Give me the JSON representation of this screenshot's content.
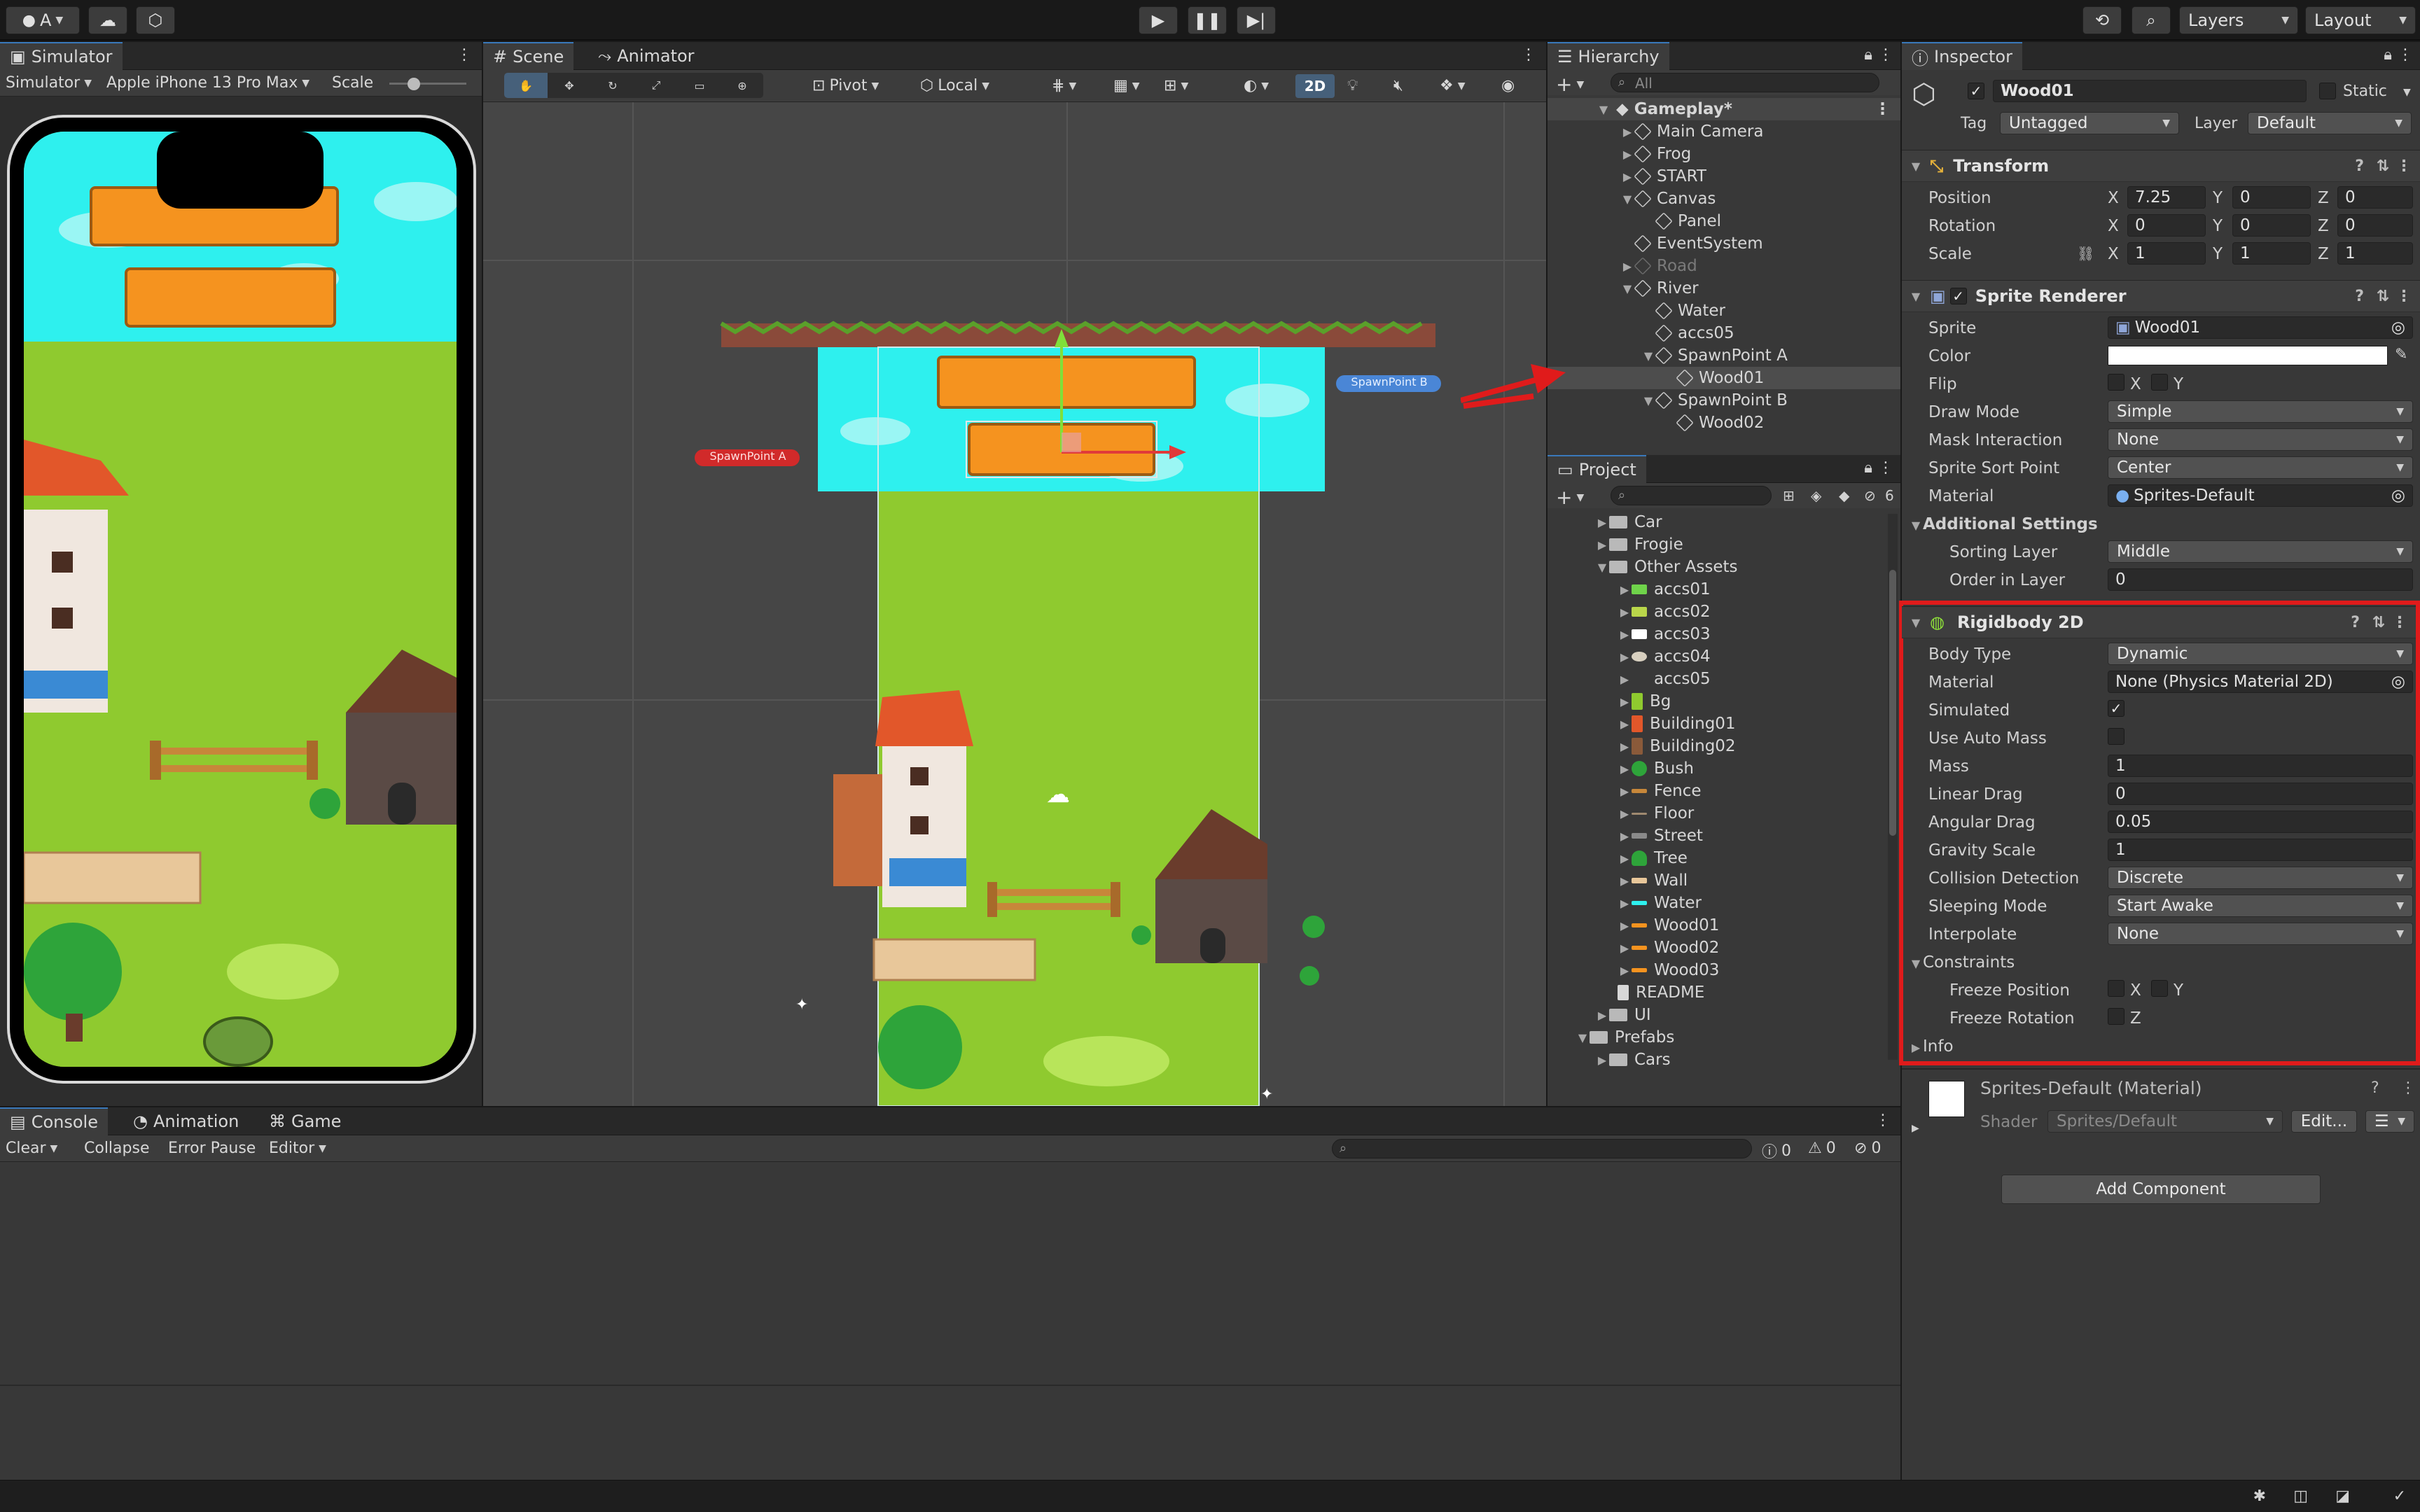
{
  "topbar": {
    "account_label": "A",
    "layers_label": "Layers",
    "layout_label": "Layout"
  },
  "simulator": {
    "tab": "Simulator",
    "mode": "Simulator",
    "device": "Apple iPhone 13 Pro Max",
    "scale_label": "Scale"
  },
  "scene": {
    "tab_scene": "Scene",
    "tab_animator": "Animator",
    "pivot": "Pivot",
    "local": "Local",
    "mode_2d": "2D",
    "spawn_a": "SpawnPoint A",
    "spawn_b": "SpawnPoint B"
  },
  "hierarchy": {
    "tab": "Hierarchy",
    "search_placeholder": "All",
    "scene_name": "Gameplay*",
    "items": [
      {
        "label": "Main Camera"
      },
      {
        "label": "Frog"
      },
      {
        "label": "START"
      },
      {
        "label": "Canvas"
      },
      {
        "label": "Panel"
      },
      {
        "label": "EventSystem"
      },
      {
        "label": "Road"
      },
      {
        "label": "River"
      },
      {
        "label": "Water"
      },
      {
        "label": "accs05"
      },
      {
        "label": "SpawnPoint A"
      },
      {
        "label": "Wood01"
      },
      {
        "label": "SpawnPoint B"
      },
      {
        "label": "Wood02"
      }
    ]
  },
  "project": {
    "tab": "Project",
    "hidden_count": "6",
    "items": [
      {
        "label": "Car"
      },
      {
        "label": "Frogie"
      },
      {
        "label": "Other Assets"
      },
      {
        "label": "accs01"
      },
      {
        "label": "accs02"
      },
      {
        "label": "accs03"
      },
      {
        "label": "accs04"
      },
      {
        "label": "accs05"
      },
      {
        "label": "Bg"
      },
      {
        "label": "Building01"
      },
      {
        "label": "Building02"
      },
      {
        "label": "Bush"
      },
      {
        "label": "Fence"
      },
      {
        "label": "Floor"
      },
      {
        "label": "Street"
      },
      {
        "label": "Tree"
      },
      {
        "label": "Wall"
      },
      {
        "label": "Water"
      },
      {
        "label": "Wood01"
      },
      {
        "label": "Wood02"
      },
      {
        "label": "Wood03"
      },
      {
        "label": "README"
      },
      {
        "label": "UI"
      },
      {
        "label": "Prefabs"
      },
      {
        "label": "Cars"
      }
    ]
  },
  "inspector": {
    "tab": "Inspector",
    "object_name": "Wood01",
    "static_label": "Static",
    "tag_label": "Tag",
    "tag_value": "Untagged",
    "layer_label": "Layer",
    "layer_value": "Default",
    "transform": {
      "title": "Transform",
      "position_label": "Position",
      "rotation_label": "Rotation",
      "scale_label": "Scale",
      "pos_x": "7.25",
      "pos_y": "0",
      "pos_z": "0",
      "rot_x": "0",
      "rot_y": "0",
      "rot_z": "0",
      "scl_x": "1",
      "scl_y": "1",
      "scl_z": "1"
    },
    "sprite_renderer": {
      "title": "Sprite Renderer",
      "sprite_label": "Sprite",
      "sprite_value": "Wood01",
      "color_label": "Color",
      "flip_label": "Flip",
      "draw_mode_label": "Draw Mode",
      "draw_mode_value": "Simple",
      "mask_label": "Mask Interaction",
      "mask_value": "None",
      "sort_point_label": "Sprite Sort Point",
      "sort_point_value": "Center",
      "material_label": "Material",
      "material_value": "Sprites-Default",
      "additional_label": "Additional Settings",
      "sorting_layer_label": "Sorting Layer",
      "sorting_layer_value": "Middle",
      "order_label": "Order in Layer",
      "order_value": "0"
    },
    "rigidbody": {
      "title": "Rigidbody 2D",
      "body_type_label": "Body Type",
      "body_type_value": "Dynamic",
      "material_label": "Material",
      "material_value": "None (Physics Material 2D)",
      "simulated_label": "Simulated",
      "auto_mass_label": "Use Auto Mass",
      "mass_label": "Mass",
      "mass_value": "1",
      "linear_drag_label": "Linear Drag",
      "linear_drag_value": "0",
      "angular_drag_label": "Angular Drag",
      "angular_drag_value": "0.05",
      "gravity_label": "Gravity Scale",
      "gravity_value": "1",
      "collision_label": "Collision Detection",
      "collision_value": "Discrete",
      "sleeping_label": "Sleeping Mode",
      "sleeping_value": "Start Awake",
      "interpolate_label": "Interpolate",
      "interpolate_value": "None",
      "constraints_label": "Constraints",
      "freeze_pos_label": "Freeze Position",
      "freeze_rot_label": "Freeze Rotation",
      "info_label": "Info"
    },
    "material_block": {
      "title": "Sprites-Default (Material)",
      "shader_label": "Shader",
      "shader_value": "Sprites/Default",
      "edit_label": "Edit..."
    },
    "add_component": "Add Component"
  },
  "console": {
    "tab_console": "Console",
    "tab_animation": "Animation",
    "tab_game": "Game",
    "clear": "Clear",
    "collapse": "Collapse",
    "error_pause": "Error Pause",
    "editor": "Editor",
    "log_count": "0",
    "warn_count": "0",
    "error_count": "0"
  },
  "colors": {
    "accent": "#3a79bb",
    "highlight_red": "#e01b1b",
    "water": "#2ef0ee",
    "grass": "#8fca2f",
    "wood": "#f5931f"
  }
}
